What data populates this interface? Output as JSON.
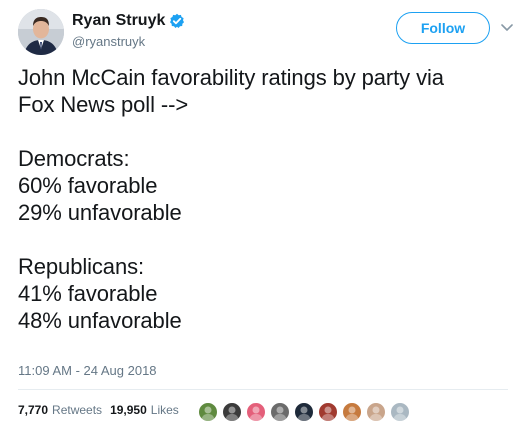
{
  "author": {
    "display_name": "Ryan Struyk",
    "handle": "@ryanstruyk",
    "verified_icon": "verified-badge-icon"
  },
  "actions": {
    "follow_label": "Follow",
    "caret_icon": "chevron-down-icon"
  },
  "tweet": {
    "lines": [
      "John McCain favorability ratings by party via",
      "Fox News poll -->",
      "Democrats:",
      "60% favorable",
      "29% unfavorable",
      "Republicans:",
      "41% favorable",
      "48% unfavorable"
    ]
  },
  "meta": {
    "timestamp": "11:09 AM - 24 Aug 2018"
  },
  "stats": {
    "retweets_count": "7,770",
    "retweets_label": "Retweets",
    "likes_count": "19,950",
    "likes_label": "Likes"
  },
  "colors": {
    "accent": "#1da1f2",
    "text": "#14171a",
    "muted": "#657786",
    "divider": "#e6ecf0"
  },
  "liker_avatars": [
    {
      "icon": "leaf-avatar-icon",
      "color": "#5f8a3f"
    },
    {
      "icon": "dark-avatar-icon",
      "color": "#3b3b3b"
    },
    {
      "icon": "pink-avatar-icon",
      "color": "#e45f7a"
    },
    {
      "icon": "gray-avatar-icon",
      "color": "#6b6b6b"
    },
    {
      "icon": "silhouette-avatar-icon",
      "color": "#1e2a3a"
    },
    {
      "icon": "red-avatar-icon",
      "color": "#a13a2f"
    },
    {
      "icon": "orange-avatar-icon",
      "color": "#c67a3e"
    },
    {
      "icon": "face-avatar-icon",
      "color": "#c9a58b"
    },
    {
      "icon": "default-avatar-icon",
      "color": "#aab8c2"
    }
  ]
}
